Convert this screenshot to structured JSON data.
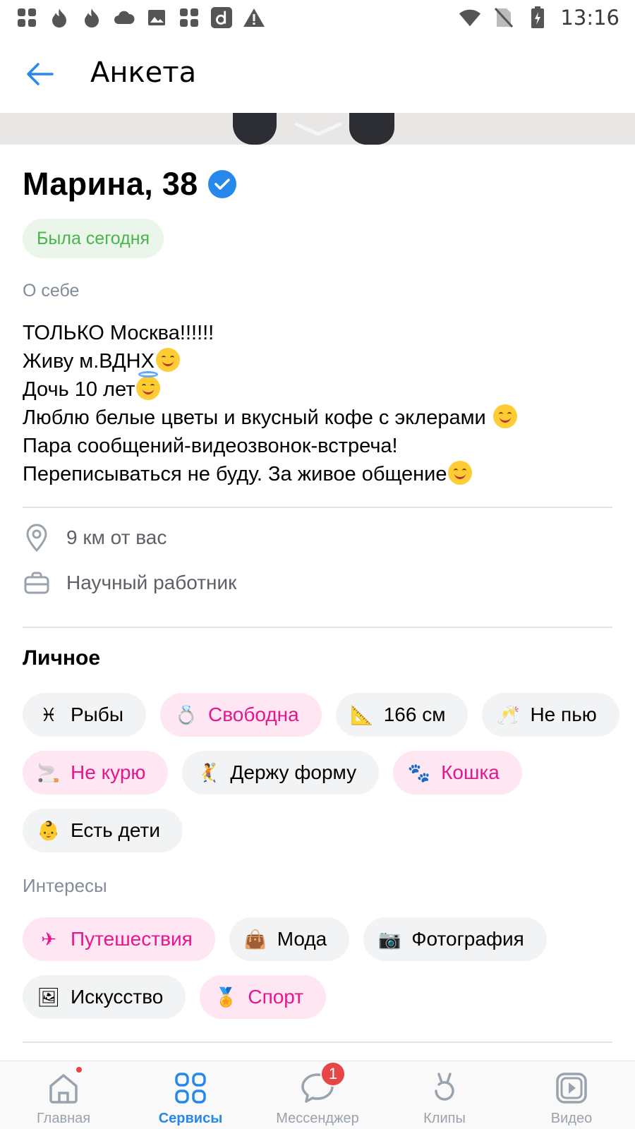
{
  "status_bar": {
    "time": "13:16",
    "left_icons": [
      "slack-icon",
      "flame-icon",
      "flame-icon",
      "cloud-icon",
      "image-icon",
      "slack-icon",
      "app-d-icon",
      "warning-icon"
    ],
    "right_icons": [
      "wifi-icon",
      "no-signal-icon",
      "battery-icon"
    ]
  },
  "app_bar": {
    "title": "Анкета"
  },
  "profile": {
    "name": "Марина, 38",
    "status": "Была сегодня",
    "about_label": "О себе",
    "about_lines": [
      {
        "text": "ТОЛЬКО Москва!!!!!!",
        "emoji": ""
      },
      {
        "text": "Живу м.ВДНХ",
        "emoji": "smile"
      },
      {
        "text": "Дочь 10 лет",
        "emoji": "halo"
      },
      {
        "text": "Люблю белые цветы и вкусный кофе с эклерами ",
        "emoji": "grin"
      },
      {
        "text": "Пара сообщений-видеозвонок-встреча!",
        "emoji": ""
      },
      {
        "text": "Переписываться не буду. За живое общение",
        "emoji": "smile"
      }
    ],
    "distance": "9 км от вас",
    "job": "Научный работник"
  },
  "personal": {
    "title": "Личное",
    "chips": [
      {
        "label": "Рыбы",
        "icon": "♓",
        "pink": false
      },
      {
        "label": "Свободна",
        "icon": "💍",
        "pink": true
      },
      {
        "label": "166 см",
        "icon": "📐",
        "pink": false
      },
      {
        "label": "Не пью",
        "icon": "🥂",
        "pink": false
      },
      {
        "label": "Не курю",
        "icon": "🚬",
        "pink": true
      },
      {
        "label": "Держу форму",
        "icon": "🤾",
        "pink": false
      },
      {
        "label": "Кошка",
        "icon": "🐾",
        "pink": true
      },
      {
        "label": "Есть дети",
        "icon": "👶",
        "pink": false
      }
    ]
  },
  "interests": {
    "title": "Интересы",
    "chips": [
      {
        "label": "Путешествия",
        "icon": "✈",
        "pink": true
      },
      {
        "label": "Мода",
        "icon": "👜",
        "pink": false
      },
      {
        "label": "Фотография",
        "icon": "📷",
        "pink": false
      },
      {
        "label": "Искусство",
        "icon": "🖼",
        "pink": false
      },
      {
        "label": "Спорт",
        "icon": "🏅",
        "pink": true
      }
    ]
  },
  "bottom_nav": {
    "items": [
      {
        "label": "Главная",
        "active": false
      },
      {
        "label": "Сервисы",
        "active": true
      },
      {
        "label": "Мессенджер",
        "active": false,
        "badge": "1"
      },
      {
        "label": "Клипы",
        "active": false
      },
      {
        "label": "Видео",
        "active": false
      }
    ]
  },
  "colors": {
    "accent": "#2688eb",
    "online_green": "#4bb34b",
    "pink": "#e6168f",
    "badge_red": "#e64646"
  }
}
